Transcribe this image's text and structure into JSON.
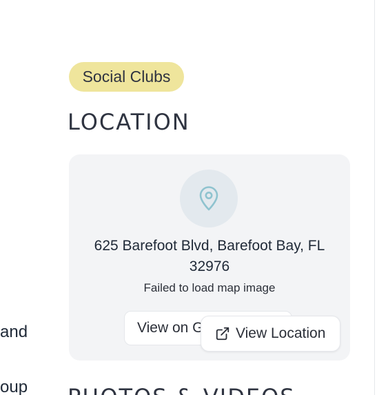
{
  "left_column": {
    "partial_line_1": "and",
    "partial_line_2": "oup"
  },
  "category_badge": {
    "label": "Social Clubs",
    "color": "#efe59c"
  },
  "location": {
    "heading": "LOCATION",
    "address_line_1": "625 Barefoot Blvd, Barefoot Bay, FL",
    "address_line_2": "32976",
    "map_error": "Failed to load map image",
    "google_maps_button": "View on Google Maps",
    "view_location_button": "View Location",
    "pin_icon": "map-pin-icon",
    "external_icon": "external-link-icon",
    "accent_color": "#8fc3cf"
  },
  "photos": {
    "heading": "PHOTOS & VIDEOS"
  }
}
